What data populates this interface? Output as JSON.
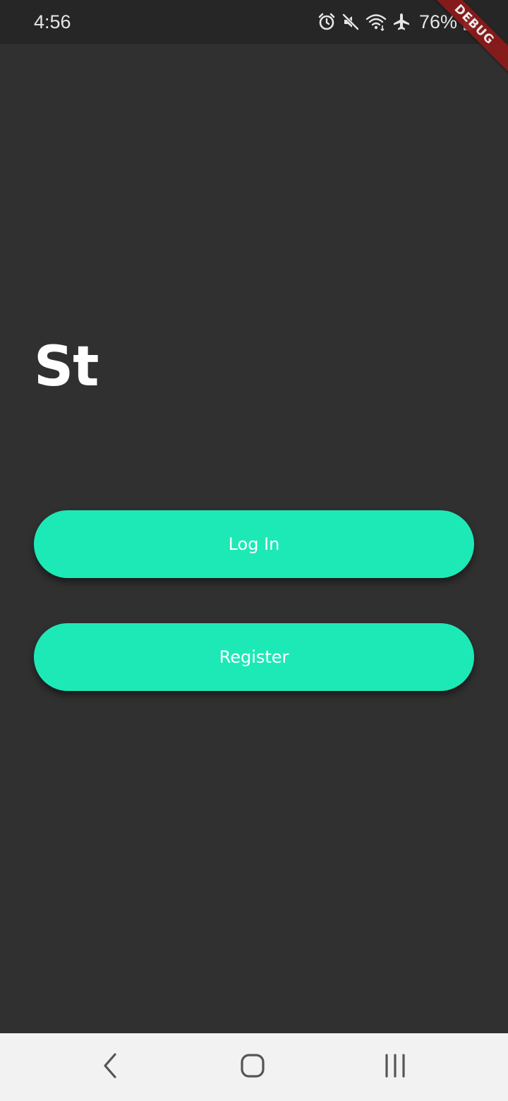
{
  "status_bar": {
    "time": "4:56",
    "battery": "76%",
    "icons": [
      "alarm-icon",
      "mute-icon",
      "wifi-icon",
      "airplane-icon",
      "battery-icon"
    ]
  },
  "debug_banner": "DEBUG",
  "app": {
    "title": "St",
    "login_label": "Log In",
    "register_label": "Register"
  },
  "colors": {
    "background": "#303030",
    "accent": "#1de9b6",
    "status_bar": "#262626",
    "nav_bar": "#f2f2f2"
  },
  "nav_bar": {
    "icons": [
      "back-icon",
      "home-icon",
      "recent-apps-icon"
    ]
  }
}
